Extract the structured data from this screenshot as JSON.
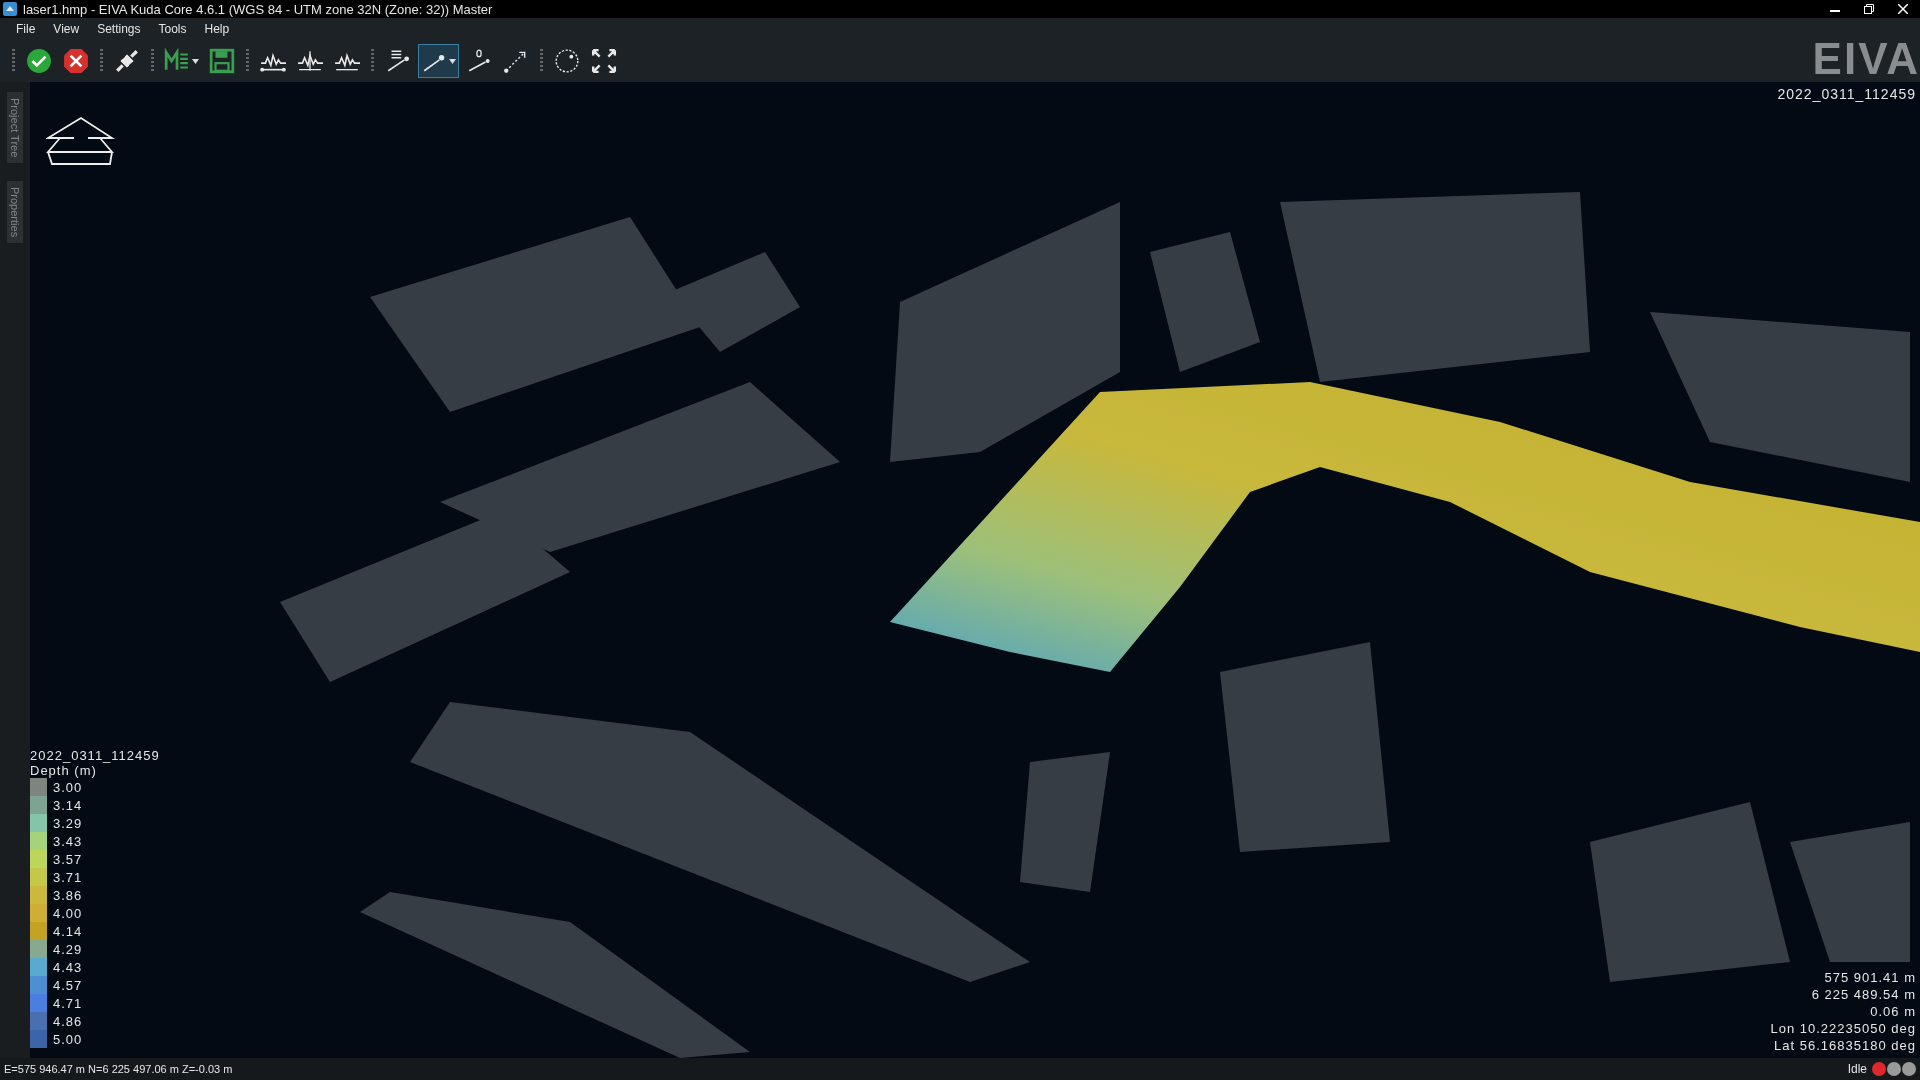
{
  "window": {
    "title": "laser1.hmp - EIVA Kuda Core 4.6.1 (WGS 84 - UTM zone 32N (Zone: 32)) Master"
  },
  "menu": [
    "File",
    "View",
    "Settings",
    "Tools",
    "Help"
  ],
  "toolbar": [
    {
      "kind": "accept",
      "selected": false,
      "dropdown": false
    },
    {
      "kind": "reject",
      "selected": false,
      "dropdown": false
    },
    {
      "kind": "connect",
      "selected": false,
      "dropdown": false
    },
    {
      "kind": "markdown",
      "selected": false,
      "dropdown": true
    },
    {
      "kind": "save",
      "selected": false,
      "dropdown": false
    },
    {
      "kind": "wave-baseline",
      "selected": false,
      "dropdown": false
    },
    {
      "kind": "wave-marker",
      "selected": false,
      "dropdown": false
    },
    {
      "kind": "wave",
      "selected": false,
      "dropdown": false
    },
    {
      "kind": "point-list",
      "selected": false,
      "dropdown": false
    },
    {
      "kind": "point",
      "selected": true,
      "dropdown": true
    },
    {
      "kind": "point-zero",
      "selected": false,
      "dropdown": false
    },
    {
      "kind": "measure",
      "selected": false,
      "dropdown": false
    },
    {
      "kind": "circle",
      "selected": false,
      "dropdown": false
    },
    {
      "kind": "fullscreen",
      "selected": false,
      "dropdown": false
    }
  ],
  "logo": "EIVA",
  "side_tabs": [
    "Project Tree",
    "Properties"
  ],
  "viewport": {
    "dataset_name": "2022_0311_112459",
    "legend": {
      "dataset_name": "2022_0311_112459",
      "title": "Depth (m)",
      "entries": [
        {
          "label": "3.00",
          "color": "#7d8580"
        },
        {
          "label": "3.14",
          "color": "#7fa393"
        },
        {
          "label": "3.29",
          "color": "#84c4a8"
        },
        {
          "label": "3.43",
          "color": "#a6d27c"
        },
        {
          "label": "3.57",
          "color": "#bcd55a"
        },
        {
          "label": "3.71",
          "color": "#c4c848"
        },
        {
          "label": "3.86",
          "color": "#cdb83e"
        },
        {
          "label": "4.00",
          "color": "#cfae34"
        },
        {
          "label": "4.14",
          "color": "#c3a224"
        },
        {
          "label": "4.29",
          "color": "#88a890"
        },
        {
          "label": "4.43",
          "color": "#5aaad0"
        },
        {
          "label": "4.57",
          "color": "#4d8fd2"
        },
        {
          "label": "4.71",
          "color": "#4a7ee0"
        },
        {
          "label": "4.86",
          "color": "#4a6fb0"
        },
        {
          "label": "5.00",
          "color": "#3d64a8"
        }
      ]
    },
    "cursor_readout": [
      "575 901.41 m",
      "6 225 489.54 m",
      "0.06 m",
      "Lon 10.22235050 deg",
      "Lat 56.16835180 deg"
    ]
  },
  "status_bar": {
    "coordinates": "E=575 946.47 m N=6 225 497.06 m Z=-0.03 m",
    "state": "Idle",
    "indicators": [
      {
        "color": "#e0282c"
      },
      {
        "color": "#9a9a9a"
      },
      {
        "color": "#9a9a9a"
      }
    ]
  }
}
